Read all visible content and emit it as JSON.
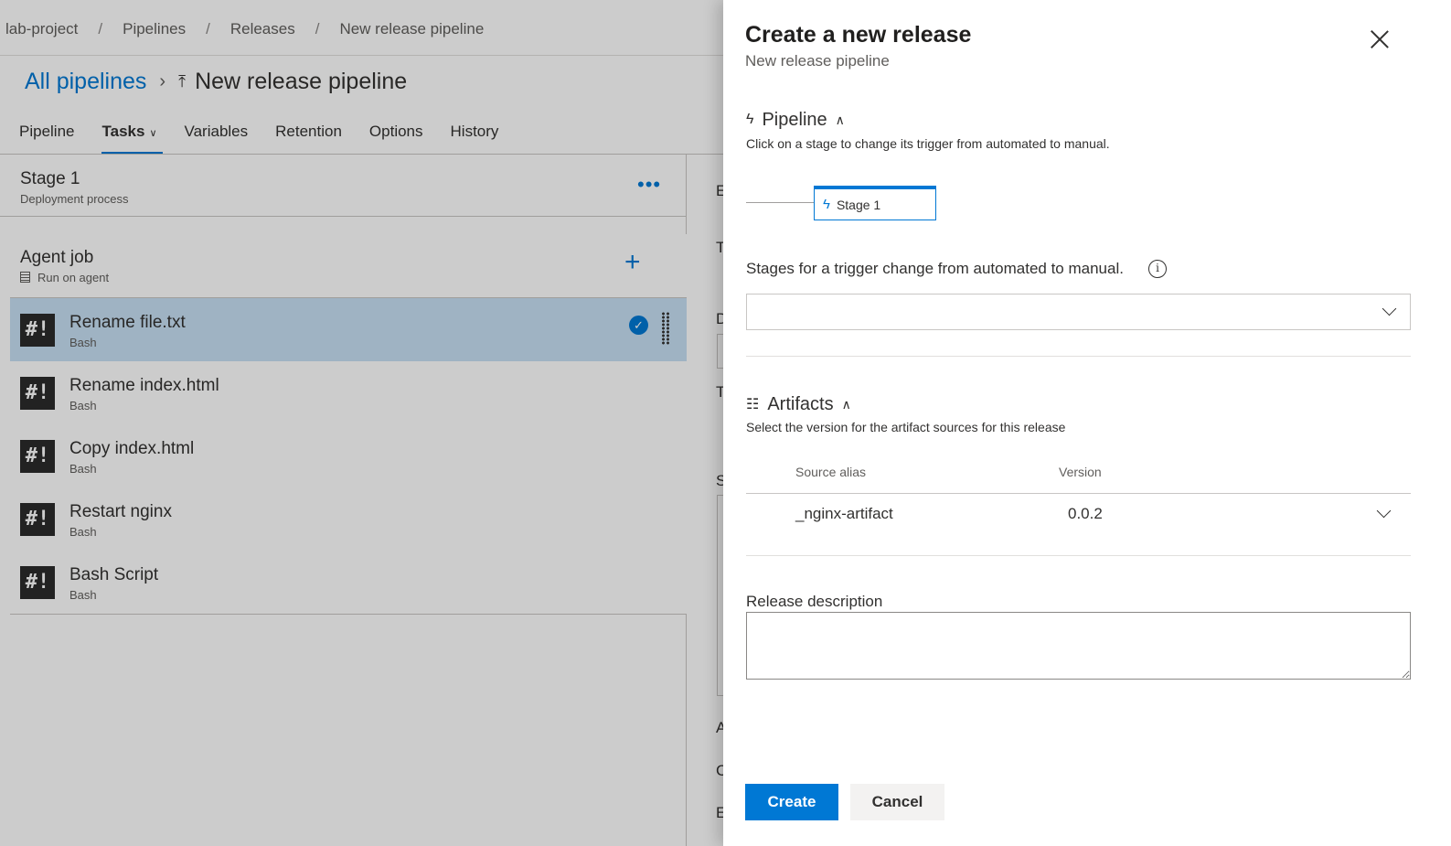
{
  "breadcrumb": [
    "lab-project",
    "Pipelines",
    "Releases",
    "New release pipeline"
  ],
  "header": {
    "all_pipelines": "All pipelines",
    "pipeline_name": "New release pipeline"
  },
  "tabs": [
    "Pipeline",
    "Tasks",
    "Variables",
    "Retention",
    "Options",
    "History"
  ],
  "stage": {
    "name": "Stage 1",
    "subtitle": "Deployment process"
  },
  "agent_job": {
    "name": "Agent job",
    "subtitle": "Run on agent"
  },
  "tasks": [
    {
      "name": "Rename file.txt",
      "type": "Bash"
    },
    {
      "name": "Rename index.html",
      "type": "Bash"
    },
    {
      "name": "Copy index.html",
      "type": "Bash"
    },
    {
      "name": "Restart nginx",
      "type": "Bash"
    },
    {
      "name": "Bash Script",
      "type": "Bash"
    }
  ],
  "peek_letters": [
    "E",
    "T",
    "D",
    "T",
    "S",
    "A",
    "C",
    "E"
  ],
  "dialog": {
    "title": "Create a new release",
    "subtitle": "New release pipeline",
    "pipeline_section": {
      "title": "Pipeline",
      "description": "Click on a stage to change its trigger from automated to manual.",
      "stage_chip": "Stage 1"
    },
    "trigger_label": "Stages for a trigger change from automated to manual.",
    "artifacts_section": {
      "title": "Artifacts",
      "description": "Select the version for the artifact sources for this release",
      "columns": [
        "Source alias",
        "Version"
      ],
      "rows": [
        {
          "alias": "_nginx-artifact",
          "version": "0.0.2"
        }
      ]
    },
    "release_description_label": "Release description",
    "create_label": "Create",
    "cancel_label": "Cancel"
  },
  "colors": {
    "accent": "#0078d4",
    "selected_row": "#c7e0f4"
  }
}
